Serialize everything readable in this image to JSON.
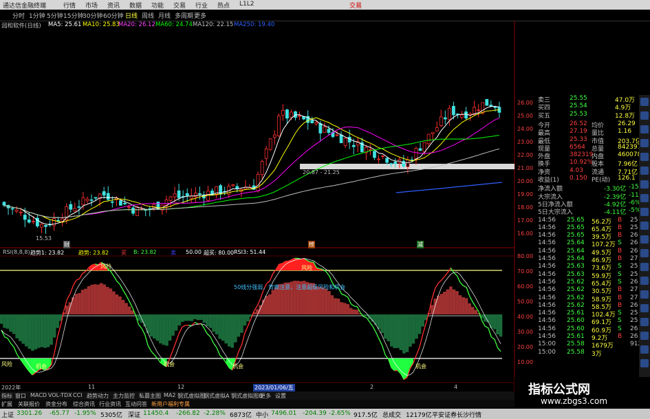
{
  "titlebar": {
    "app_title": "通达信金融终端",
    "menus": [
      "行情",
      "市场",
      "资讯",
      "数据",
      "功能",
      "交易",
      "行业",
      "热点",
      "L1L2"
    ],
    "right_label": "交易"
  },
  "periods": {
    "items": [
      "分时",
      "1分钟",
      "5分钟",
      "15分钟",
      "30分钟",
      "60分钟",
      "日线",
      "周线",
      "月线",
      "多周期",
      "更多"
    ],
    "active_index": 6
  },
  "ma_legend": {
    "stock": "润和软件(日线)",
    "ma5": "MA5: 25.61",
    "ma10": "MA10: 25.83",
    "ma20": "MA20: 26.12",
    "ma60": "MA60: 24.74",
    "ma120": "MA120: 22.15",
    "ma250": "MA250: 19.40",
    "colors": {
      "ma5": "#ffffff",
      "ma10": "#ffff00",
      "ma20": "#ff00ff",
      "ma60": "#00ff00",
      "ma120": "#c0c0c0",
      "ma250": "#3060ff"
    }
  },
  "price_axis": [
    "26.00",
    "25.00",
    "24.00",
    "23.00",
    "22.00",
    "21.00",
    "20.00",
    "19.00",
    "18.00",
    "17.00",
    "16.00"
  ],
  "price_annotations": {
    "low": "15.53",
    "range": "20.87 - 21.25"
  },
  "markers": [
    "财",
    "榜",
    "减"
  ],
  "rsi_legend": {
    "name": "RSI(8,8,8)",
    "trend1": "趋势1: 23.82",
    "trend": "趋势: 23.82",
    "buy": "买",
    "b": "B: 23.82",
    "sell": "卖",
    "v1": "50.00",
    "sbuy": "超买: 80.00",
    "rsi3": "RSI3: 51.44"
  },
  "rsi_axis": [
    "80.00",
    "70.00",
    "60.00",
    "50.00",
    "40.00",
    "30.00",
    "20.00",
    "10.00"
  ],
  "rsi_annotations": {
    "signal_text": "50线分强弱，背离注意，注意超级风险和机会",
    "chance": "机会",
    "risk": "风险",
    "label_left": "风险"
  },
  "date_labels": [
    "2022年",
    "11",
    "12",
    "2023/01/06/五",
    "2",
    "3",
    "4"
  ],
  "quote_panel": {
    "sell_rows": [
      {
        "label": "卖三",
        "price": "25.55",
        "vol": "47.0万"
      },
      {
        "label": "买四",
        "price": "25.54",
        "vol": "4.9万"
      },
      {
        "label": "买五",
        "price": "25.53",
        "vol": "12.8万"
      }
    ],
    "stats": [
      {
        "l1": "今开",
        "v1": "26.52",
        "l2": "均价",
        "v2": "26.29"
      },
      {
        "l1": "最高",
        "v1": "27.19",
        "l2": "量比",
        "v2": "1.16"
      },
      {
        "l1": "最低",
        "v1": "25.33",
        "l2": "市值",
        "v2": "203.7亿"
      },
      {
        "l1": "现量",
        "v1": "6564",
        "l2": "总量",
        "v2": "842397"
      },
      {
        "l1": "外盘",
        "v1": "382319",
        "l2": "内盘",
        "v2": "460078"
      },
      {
        "l1": "换手",
        "v1": "10.92%",
        "l2": "股本",
        "v2": "7.96亿"
      },
      {
        "l1": "净资",
        "v1": "4.03",
        "l2": "流通",
        "v2": "7.71亿"
      },
      {
        "l1": "收益(1)",
        "v1": "0.150",
        "l2": "PE(动)",
        "v2": "126.1"
      }
    ],
    "flows": [
      {
        "label": "净流入额",
        "value": "-3.30亿",
        "pct": "-15%"
      },
      {
        "label": "大宗流入",
        "value": "-2.39亿",
        "pct": "-11%"
      },
      {
        "label": "5日净流入额",
        "value": "-4.92亿",
        "pct": "-6%"
      },
      {
        "label": "5日大宗流入",
        "value": "-4.11亿",
        "pct": "-5%"
      }
    ],
    "ticks": [
      {
        "t": "14:56",
        "p": "25.65",
        "v": "56.2万",
        "s": "B",
        "n": "25"
      },
      {
        "t": "14:56",
        "p": "25.65",
        "v": "65.4万",
        "s": "B",
        "n": "25"
      },
      {
        "t": "14:56",
        "p": "25.65",
        "v": "39.5万",
        "s": "B",
        "n": "26"
      },
      {
        "t": "14:56",
        "p": "25.64",
        "v": "107.2万",
        "s": "S",
        "n": "26"
      },
      {
        "t": "14:56",
        "p": "25.64",
        "v": "49.5万",
        "s": "B",
        "n": "26"
      },
      {
        "t": "14:56",
        "p": "25.64",
        "v": "46.9万",
        "s": "B",
        "n": "27"
      },
      {
        "t": "14:56",
        "p": "25.63",
        "v": "73.6万",
        "s": "S",
        "n": "25"
      },
      {
        "t": "14:56",
        "p": "25.63",
        "v": "59.9万",
        "s": "S",
        "n": "25"
      },
      {
        "t": "14:56",
        "p": "25.62",
        "v": "65.4万",
        "s": "S",
        "n": "26"
      },
      {
        "t": "14:56",
        "p": "25.62",
        "v": "30.5万",
        "s": "B",
        "n": "27"
      },
      {
        "t": "14:56",
        "p": "25.62",
        "v": "58.9万",
        "s": "B",
        "n": "27"
      },
      {
        "t": "14:56",
        "p": "25.62",
        "v": "58.5万",
        "s": "B",
        "n": "26"
      },
      {
        "t": "14:56",
        "p": "25.61",
        "v": "102.4万",
        "s": "S",
        "n": "25"
      },
      {
        "t": "14:56",
        "p": "25.60",
        "v": "69.1万",
        "s": "S",
        "n": "25"
      },
      {
        "t": "14:56",
        "p": "25.60",
        "v": "60.9万",
        "s": "S",
        "n": "26"
      },
      {
        "t": "14:56",
        "p": "25.61",
        "v": "9.2万",
        "s": "B",
        "n": "26"
      },
      {
        "t": "15:00",
        "p": "25.58",
        "v": "1679万",
        "s": "",
        "n": "912"
      },
      {
        "t": "15:00",
        "p": "25.58",
        "v": "3万",
        "s": "",
        "n": ""
      }
    ]
  },
  "bottom_tabs": [
    "指标",
    "窗口",
    "MACD",
    "VOL-TDX",
    "CCI",
    "趋势动力",
    "主力监控",
    "私募主图",
    "MA2",
    "钢式虚拟图",
    "钢式虚拟A",
    "钢式虚拟图B",
    "更多",
    "设置"
  ],
  "bottom_tabs2": [
    "扩展",
    "关联报价",
    "资金分布",
    "综合资讯",
    "行业资讯",
    "互动问答",
    "新用户福利专属"
  ],
  "status": {
    "sh_label": "上证",
    "sh": "3301.26",
    "sh_chg": "-65.77",
    "sh_pct": "-1.95%",
    "sh_amt": "5305亿",
    "sz_label": "深证",
    "sz": "11450.4",
    "sz_chg": "-266.82",
    "sz_pct": "-2.28%",
    "sz_amt": "6873亿",
    "zx_label": "中小",
    "zx": "7496.01",
    "zx_chg": "-204.39",
    "zx_pct": "-2.65%",
    "zx_amt": "917.5亿",
    "total_label": "总成交",
    "total": "12179亿",
    "broker": "平安证券长沙行情"
  },
  "watermark": {
    "title": "指标公式网",
    "url": "www.zbgs3.com"
  }
}
